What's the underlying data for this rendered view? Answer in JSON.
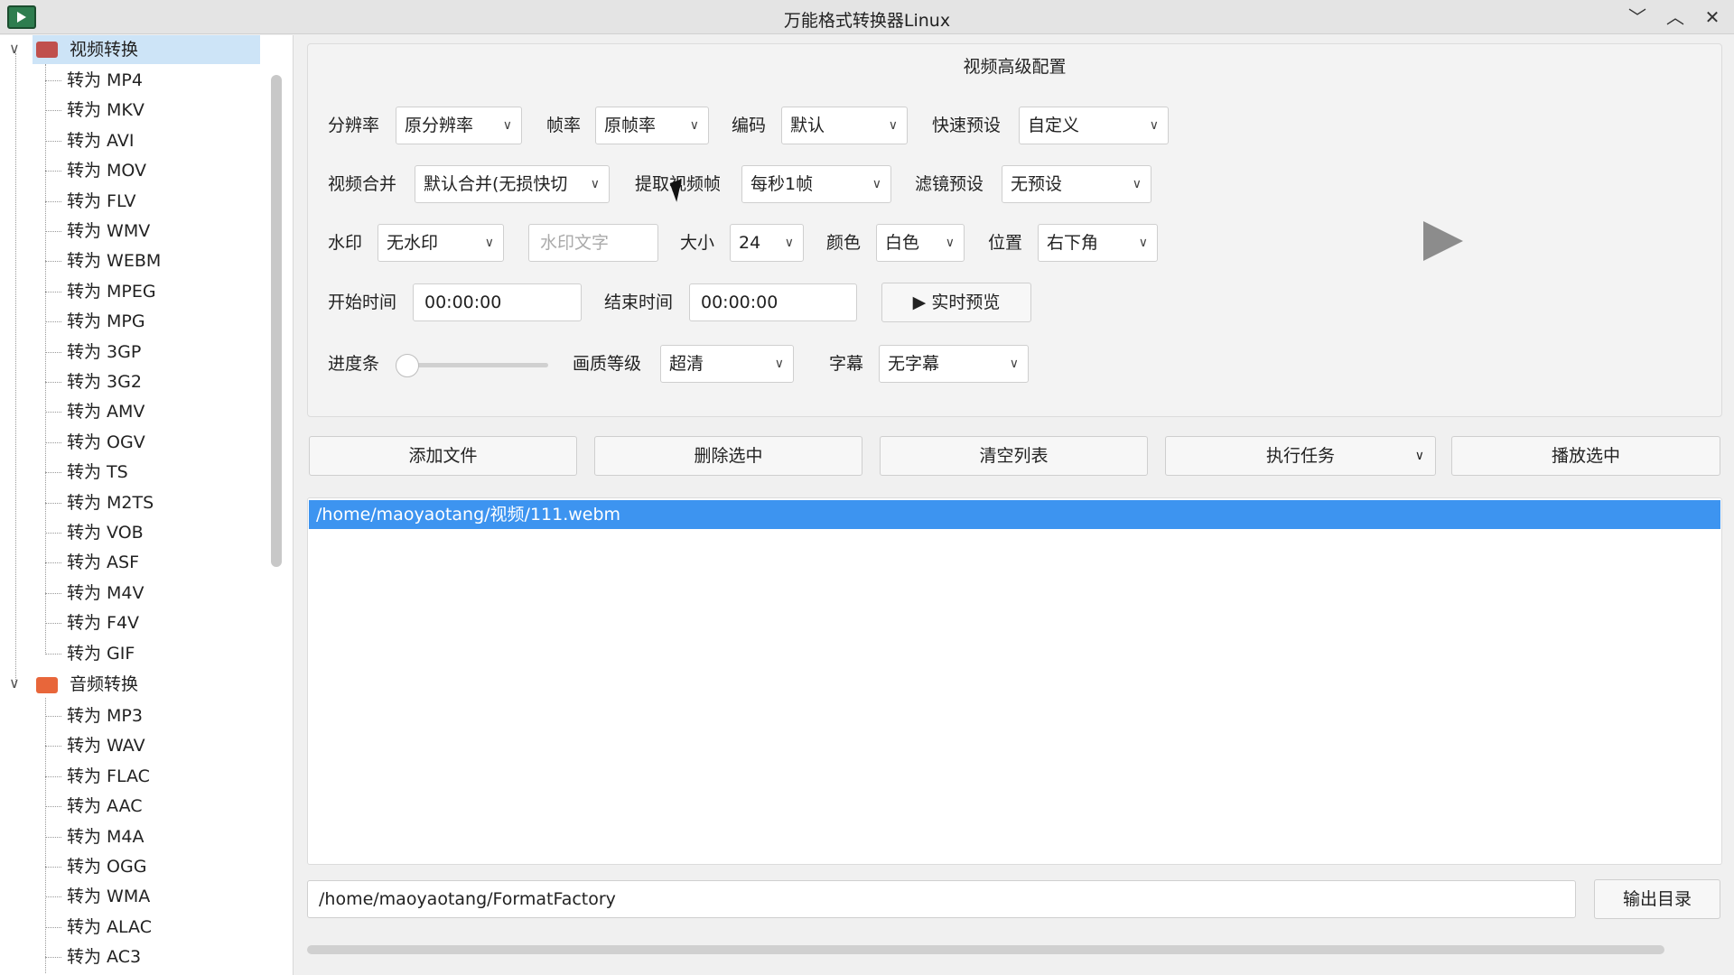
{
  "window": {
    "title": "万能格式转换器Linux"
  },
  "sidebar": {
    "video_category": "视频转换",
    "video_items": [
      "转为 MP4",
      "转为 MKV",
      "转为 AVI",
      "转为 MOV",
      "转为 FLV",
      "转为 WMV",
      "转为 WEBM",
      "转为 MPEG",
      "转为 MPG",
      "转为 3GP",
      "转为 3G2",
      "转为 AMV",
      "转为 OGV",
      "转为 TS",
      "转为 M2TS",
      "转为 VOB",
      "转为 ASF",
      "转为 M4V",
      "转为 F4V",
      "转为 GIF"
    ],
    "audio_category": "音频转换",
    "audio_items": [
      "转为 MP3",
      "转为 WAV",
      "转为 FLAC",
      "转为 AAC",
      "转为 M4A",
      "转为 OGG",
      "转为 WMA",
      "转为 ALAC",
      "转为 AC3"
    ]
  },
  "config": {
    "title": "视频高级配置",
    "resolution_label": "分辨率",
    "resolution_value": "原分辨率",
    "framerate_label": "帧率",
    "framerate_value": "原帧率",
    "codec_label": "编码",
    "codec_value": "默认",
    "preset_label": "快速预设",
    "preset_value": "自定义",
    "merge_label": "视频合并",
    "merge_value": "默认合并(无损快切",
    "extract_label": "提取视频帧",
    "extract_value": "每秒1帧",
    "filter_label": "滤镜预设",
    "filter_value": "无预设",
    "watermark_label": "水印",
    "watermark_value": "无水印",
    "watermark_text_placeholder": "水印文字",
    "size_label": "大小",
    "size_value": "24",
    "color_label": "颜色",
    "color_value": "白色",
    "position_label": "位置",
    "position_value": "右下角",
    "start_label": "开始时间",
    "start_value": "00:00:00",
    "end_label": "结束时间",
    "end_value": "00:00:00",
    "preview_button": "▶ 实时预览",
    "progress_label": "进度条",
    "progress_value": 0,
    "quality_label": "画质等级",
    "quality_value": "超清",
    "subtitle_label": "字幕",
    "subtitle_value": "无字幕"
  },
  "actions": {
    "add_file": "添加文件",
    "delete_selected": "删除选中",
    "clear_list": "清空列表",
    "run_task": "执行任务",
    "play_selected": "播放选中"
  },
  "files": [
    "/home/maoyaotang/视频/111.webm"
  ],
  "output": {
    "path": "/home/maoyaotang/FormatFactory",
    "button": "输出目录"
  }
}
